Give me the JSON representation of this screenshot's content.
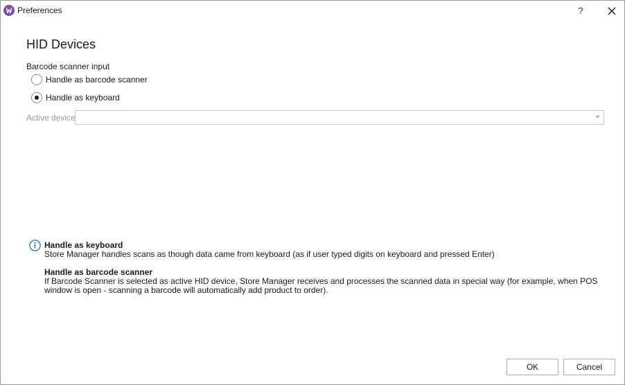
{
  "window": {
    "title": "Preferences",
    "help_label": "?"
  },
  "section": {
    "title": "HID Devices",
    "group_label": "Barcode scanner input"
  },
  "radios": [
    {
      "label": "Handle as barcode scanner",
      "selected": false
    },
    {
      "label": "Handle as keyboard",
      "selected": true
    }
  ],
  "device": {
    "label": "Active device",
    "value": ""
  },
  "info": {
    "keyboard_title": "Handle as keyboard",
    "keyboard_text": "Store Manager handles scans as though data came from keyboard (as if user typed digits on keyboard and pressed Enter)",
    "scanner_title": "Handle as barcode scanner",
    "scanner_text": "If Barcode Scanner is selected as active HID device, Store Manager receives and processes the scanned data in special way (for example, when POS window is open - scanning a barcode will automatically add product to order)."
  },
  "buttons": {
    "ok": "OK",
    "cancel": "Cancel"
  },
  "colors": {
    "app_icon": "#7b4fa3",
    "info_icon": "#2b6cb8"
  }
}
